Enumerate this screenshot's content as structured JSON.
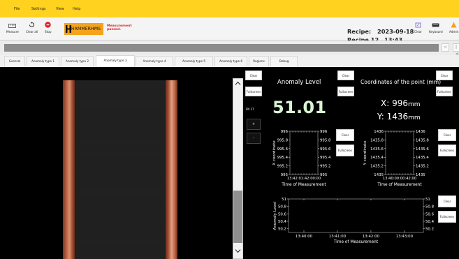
{
  "menu": {
    "file": "File",
    "settings": "Settings",
    "view": "View",
    "help": "Help"
  },
  "toolbar": {
    "measure": "Measure",
    "clear_all": "Clear all",
    "stop": "Stop",
    "clear": "Clear",
    "keyboard": "Keyboard",
    "admin": "Admin"
  },
  "logo": {
    "text": "HAMMERHMS"
  },
  "status": {
    "line1": "Measurement",
    "line2": "passed."
  },
  "recipe": {
    "label": "Recipe:",
    "date": "2023-09-18",
    "name": "Recipe 12",
    "time": "13:43"
  },
  "nav": {
    "prev": "<",
    "next": "|<"
  },
  "tabs": [
    "General",
    "Anomaly type 1",
    "Anomaly type 2",
    "Anomaly type 3",
    "Anomaly type 4",
    "Anomaly type 5",
    "Anomaly type 6",
    "Regions",
    "Debug"
  ],
  "active_tab": "Anomaly type 3",
  "controls": {
    "clear": "Clear",
    "fullscreen": "Fullscreen",
    "fn": "FN 17",
    "plus": "+",
    "minus": "-"
  },
  "anomaly": {
    "title": "Anomaly Level",
    "value": "51.01"
  },
  "coords": {
    "title": "Coordinates of the point (mm)",
    "x_label": "X:",
    "x_value": "996",
    "y_label": "Y:",
    "y_value": "1436",
    "unit": "mm"
  },
  "chart_data": [
    {
      "type": "line",
      "ylabel": "X coordinate",
      "xlabel": "Time of Measurement",
      "y_ticks": [
        "996",
        "995.8",
        "995.6",
        "995.4",
        "995.2",
        "995"
      ],
      "x_tick_label": "13:42:01:42:00:00",
      "ylim": [
        995,
        996
      ]
    },
    {
      "type": "line",
      "ylabel": "Y coordinate",
      "xlabel": "Time of Measurement",
      "y_ticks": [
        "1436",
        "1435.8",
        "1435.6",
        "1435.4",
        "1435.2",
        "1435"
      ],
      "x_tick_label": "13:40:00:00:42:00",
      "ylim": [
        1435,
        1436
      ]
    },
    {
      "type": "line",
      "ylabel": "Anomaly Level",
      "xlabel": "Time of Measurement",
      "y_ticks": [
        "51",
        "50.8",
        "50.6",
        "50.4",
        "50.2"
      ],
      "x_ticks": [
        "13:40:00",
        "13:41:00",
        "13:42:00",
        "13:43:00"
      ],
      "ylim": [
        50.1,
        51
      ]
    }
  ],
  "colors": {
    "menubar": "#ffd21f",
    "logo": "#f5a21c",
    "status": "#e0202a",
    "anomaly_value": "#d9f5d2"
  }
}
